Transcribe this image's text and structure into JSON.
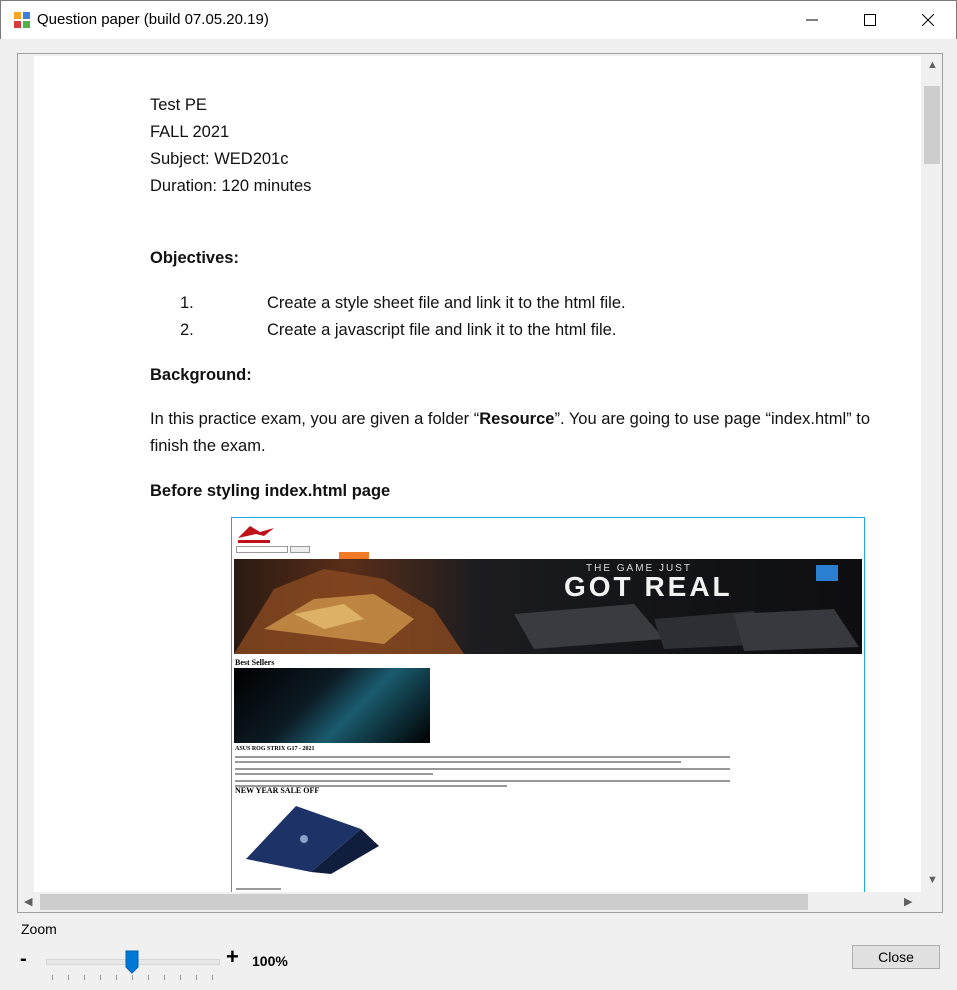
{
  "window": {
    "title": "Question paper (build 07.05.20.19)",
    "minimize_icon": "minimize-icon",
    "maximize_icon": "maximize-icon",
    "close_icon": "close-icon"
  },
  "document": {
    "header_lines": [
      "Test PE",
      "FALL 2021",
      "Subject: WED201c",
      "Duration: 120 minutes"
    ],
    "objectives_heading": "Objectives:",
    "objectives": [
      {
        "num": "1.",
        "text": "Create a style sheet file and link it to the html file."
      },
      {
        "num": "2.",
        "text": "Create a javascript  file and link it to the html file."
      }
    ],
    "background_heading": "Background:",
    "background_line1_prefix": "In this practice exam, you are given a folder “",
    "background_line1_bold": "Resource",
    "background_line1_suffix": "”. You are going to use page “index.html”  to",
    "background_line2": "finish the exam.",
    "before_styling_heading": "Before styling index.html page"
  },
  "embedded_screenshot": {
    "banner_line1": "THE GAME JUST",
    "banner_line2": "GOT REAL",
    "best_sellers": "Best Sellers",
    "product_title": "ASUS ROG STRIX G17 - 2021",
    "sale_heading": "NEW YEAR SALE OFF"
  },
  "zoom": {
    "label": "Zoom",
    "minus": "-",
    "plus": "+",
    "value": "100%",
    "level_percent": 100
  },
  "buttons": {
    "close": "Close"
  },
  "colors": {
    "accent": "#0078d7",
    "screenshot_border": "#1ea8e8",
    "orange": "#f07a26"
  }
}
